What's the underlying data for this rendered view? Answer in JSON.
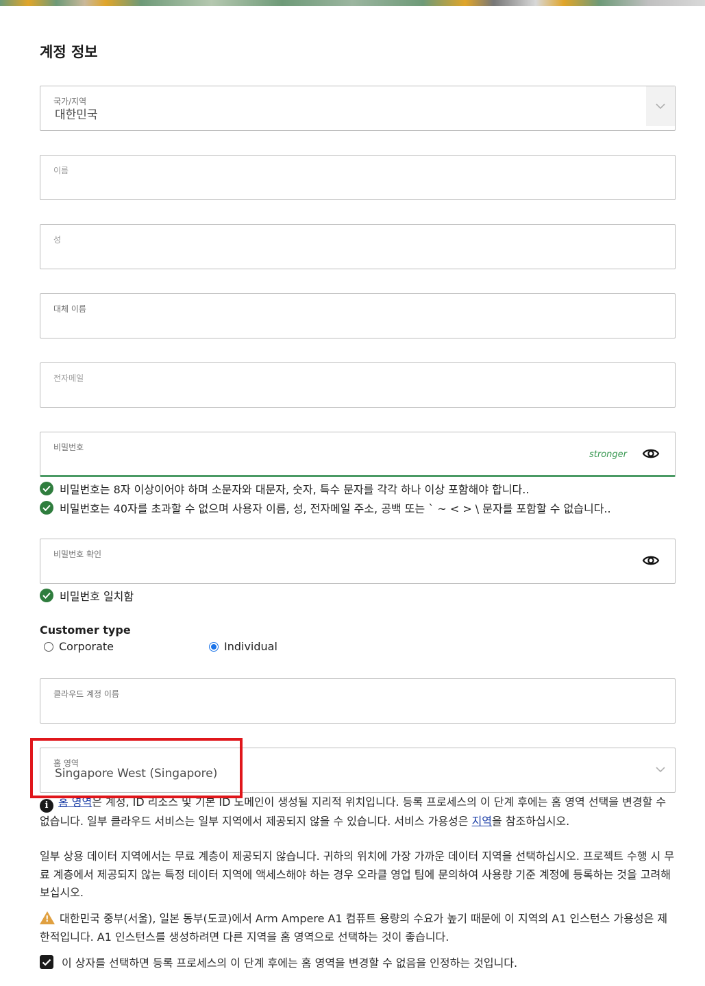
{
  "page_title": "계정 정보",
  "country": {
    "label": "국가/지역",
    "value": "대한민국"
  },
  "first_name": {
    "label": "이름"
  },
  "last_name": {
    "label": "성"
  },
  "alt_name": {
    "label": "대체 이름"
  },
  "email": {
    "label": "전자메일"
  },
  "password": {
    "label": "비밀번호",
    "strength": "stronger"
  },
  "password_rules": [
    "비밀번호는 8자 이상이어야 하며 소문자와 대문자, 숫자, 특수 문자를 각각 하나 이상 포함해야 합니다..",
    "비밀번호는 40자를 초과할 수 없으며 사용자 이름, 성, 전자메일 주소, 공백 또는 ` ~ < > \\ 문자를 포함할 수 없습니다.."
  ],
  "confirm_password": {
    "label": "비밀번호 확인",
    "match_text": "비밀번호 일치함"
  },
  "customer_type": {
    "label": "Customer type",
    "options": [
      "Corporate",
      "Individual"
    ],
    "selected": "Individual"
  },
  "cloud_account": {
    "label": "클라우드 계정 이름"
  },
  "home_region": {
    "label": "홈 영역",
    "value": "Singapore West (Singapore)"
  },
  "info": {
    "link1": "홈 영역",
    "text1": "은 계정, ID 리소스 및 기본 ID 도메인이 생성될 지리적 위치입니다. 등록 프로세스의 이 단계 후에는 홈 영역 선택을 변경할 수 없습니다. 일부 클라우드 서비스는 일부 지역에서 제공되지 않을 수 있습니다. 서비스 가용성은 ",
    "link2": "지역",
    "text2": "을 참조하십시오.",
    "paragraph2": "일부 상용 데이터 지역에서는 무료 계층이 제공되지 않습니다. 귀하의 위치에 가장 가까운 데이터 지역을 선택하십시오. 프로젝트 수행 시 무료 계층에서 제공되지 않는 특정 데이터 지역에 액세스해야 하는 경우 오라클 영업 팀에 문의하여 사용량 기준 계정에 등록하는 것을 고려해 보십시오."
  },
  "warning": "대한민국 중부(서울), 일본 동부(도쿄)에서 Arm Ampere A1 컴퓨트 용량의 수요가 높기 때문에 이 지역의 A1 인스턴스 가용성은 제한적입니다. A1 인스턴스를 생성하려면 다른 지역을 홈 영역으로 선택하는 것이 좋습니다.",
  "acknowledge": "이 상자를 선택하면 등록 프로세스의 이 단계 후에는 홈 영역을 변경할 수 없음을 인정하는 것입니다."
}
